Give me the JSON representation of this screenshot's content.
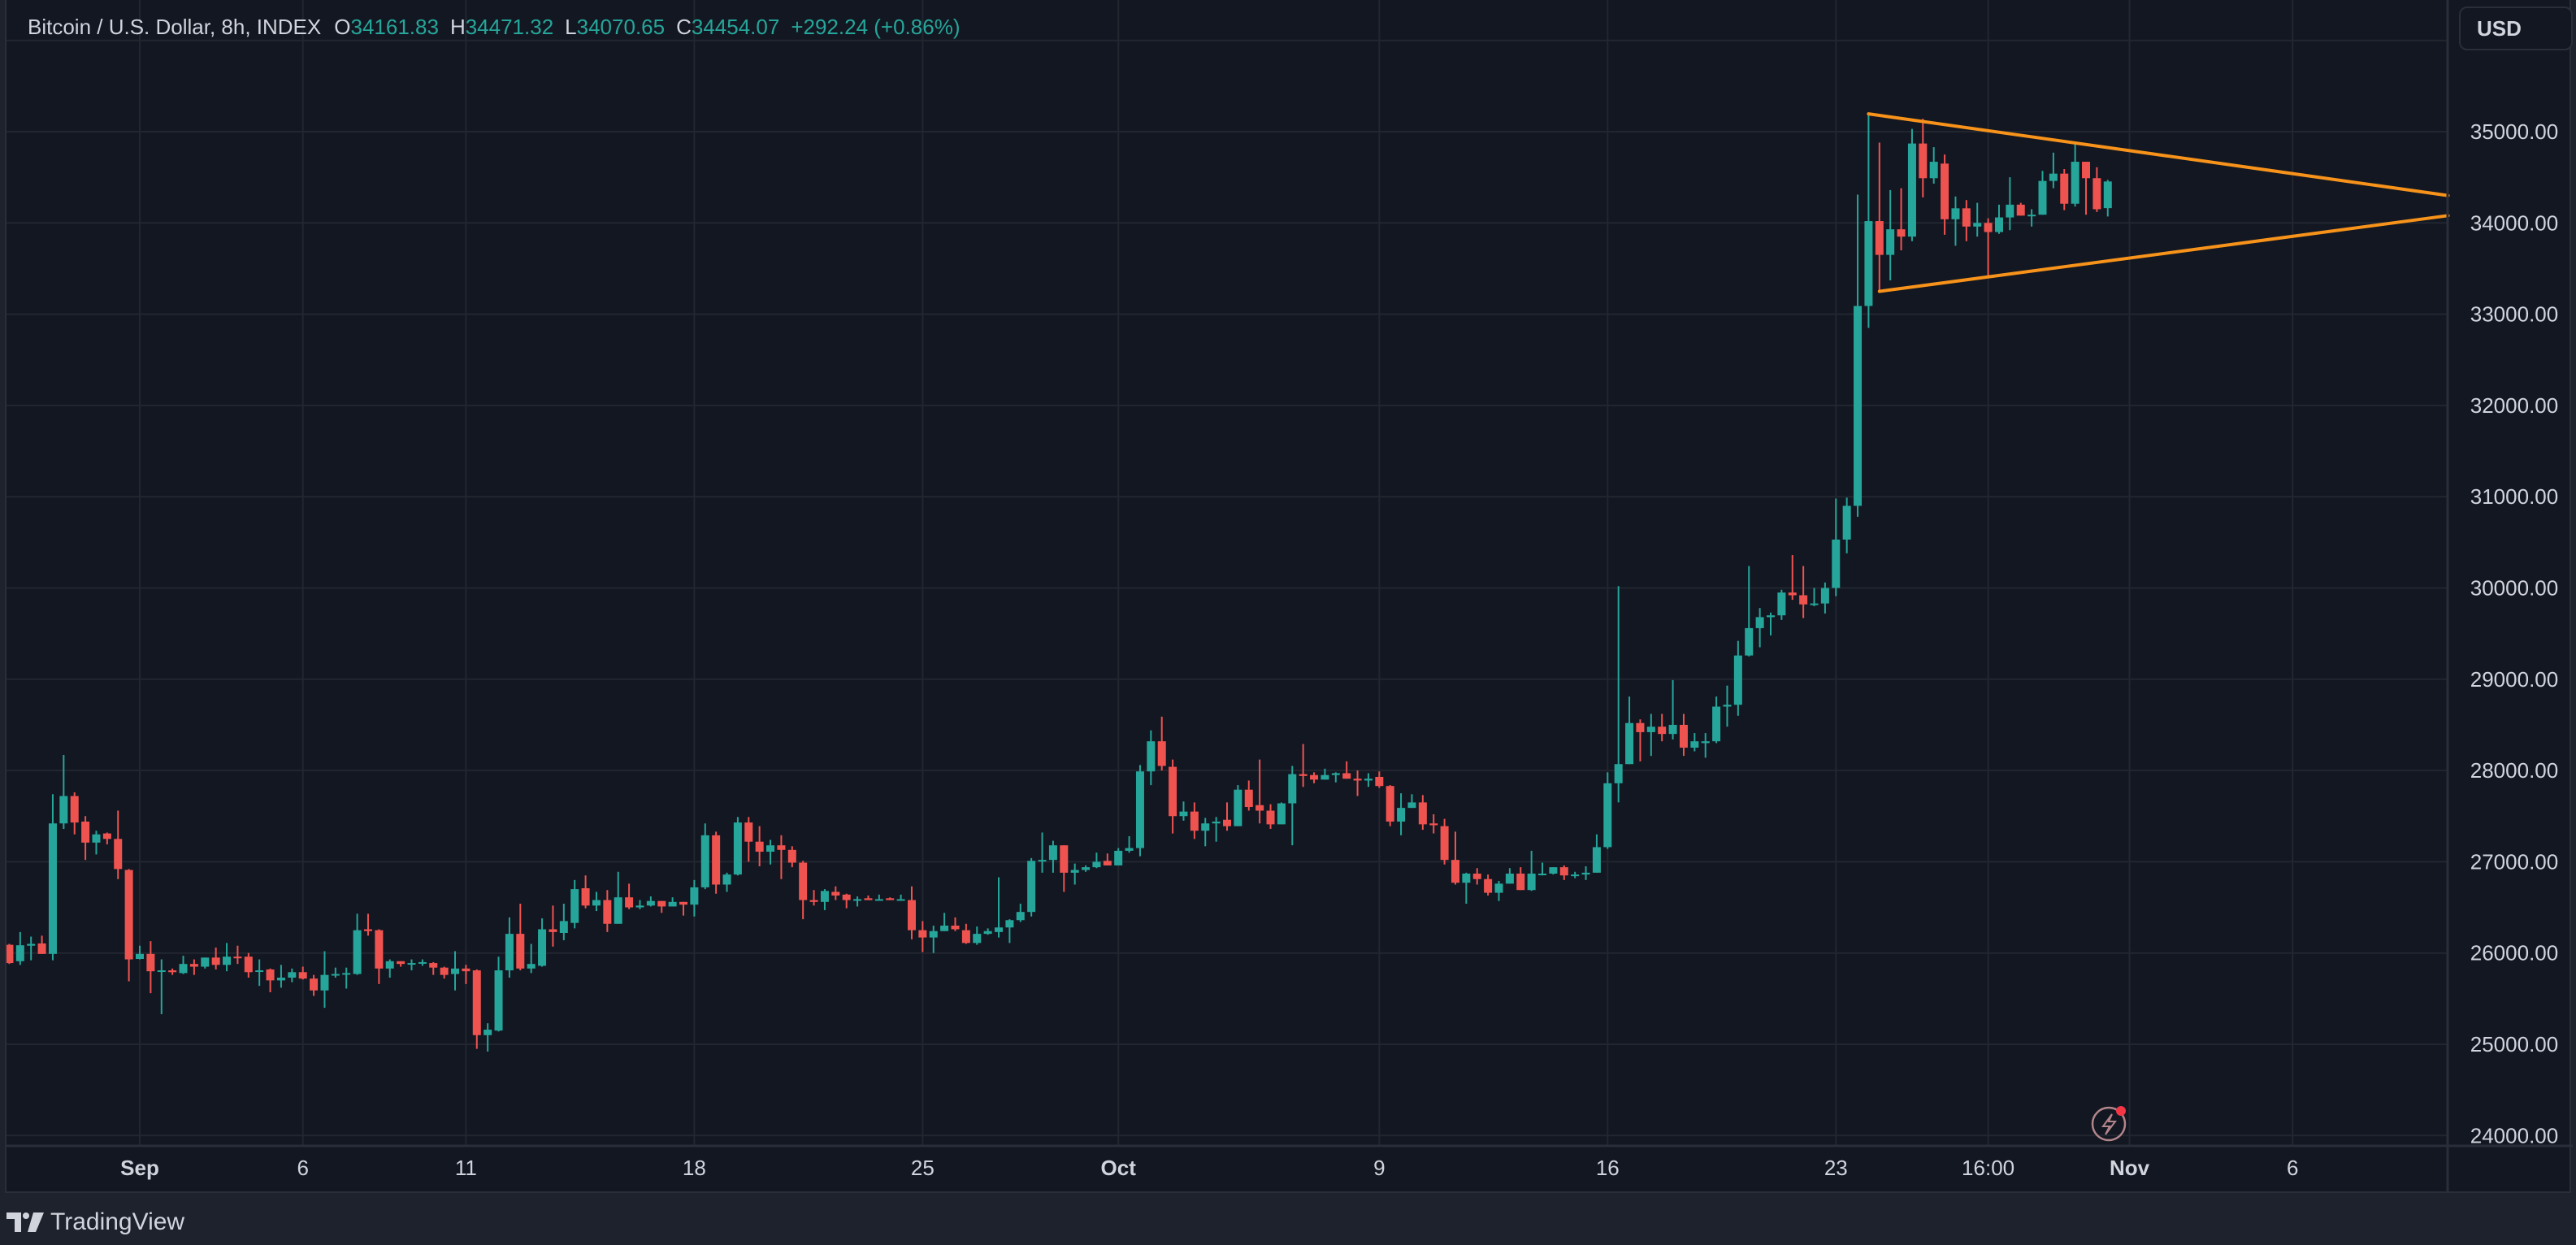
{
  "legend": {
    "symbol": "Bitcoin / U.S. Dollar, 8h, INDEX",
    "open_label": "O",
    "open": "34161.83",
    "high_label": "H",
    "high": "34471.32",
    "low_label": "L",
    "low": "34070.65",
    "close_label": "C",
    "close": "34454.07",
    "change": "+292.24 (+0.86%)"
  },
  "currency_button": "USD",
  "footer": {
    "brand": "TradingView",
    "logo_icon": "tradingview-logo-icon"
  },
  "flash_icon": {
    "name": "lightning-icon",
    "badge_color": "#f23645"
  },
  "colors": {
    "background": "#131722",
    "up": "#26a69a",
    "down": "#ef5350",
    "trendline": "#f7931a",
    "grid": "#22262f",
    "text": "#d1d4dc"
  },
  "chart_data": {
    "type": "candlestick",
    "title": "Bitcoin / U.S. Dollar, 8h, INDEX",
    "interval": "8h",
    "first_candle": "Aug 28 00:00",
    "first_candle_index_offset_from_sep1": -12,
    "ylim": [
      24000,
      36000
    ],
    "yticks": [
      "24000.00",
      "25000.00",
      "26000.00",
      "27000.00",
      "28000.00",
      "29000.00",
      "30000.00",
      "31000.00",
      "32000.00",
      "33000.00",
      "34000.00",
      "35000.00"
    ],
    "xticks": [
      {
        "label": "Sep",
        "index": 0,
        "major": true
      },
      {
        "label": "6",
        "index": 15
      },
      {
        "label": "11",
        "index": 30
      },
      {
        "label": "18",
        "index": 51
      },
      {
        "label": "25",
        "index": 72
      },
      {
        "label": "Oct",
        "index": 90,
        "major": true
      },
      {
        "label": "9",
        "index": 114
      },
      {
        "label": "16",
        "index": 135
      },
      {
        "label": "23",
        "index": 156
      },
      {
        "label": "16:00",
        "index": 170
      },
      {
        "label": "Nov",
        "index": 183,
        "major": true
      },
      {
        "label": "6",
        "index": 198
      }
    ],
    "x_range_index": [
      -12.6,
      212.3
    ],
    "grid": true,
    "ohlc": [
      [
        26090,
        26100,
        25880,
        25890
      ],
      [
        25910,
        26230,
        25870,
        26085
      ],
      [
        26080,
        26180,
        25920,
        26100
      ],
      [
        26105,
        26190,
        25990,
        25990
      ],
      [
        25990,
        27740,
        25920,
        27420
      ],
      [
        27420,
        28170,
        27360,
        27720
      ],
      [
        27720,
        27760,
        27300,
        27430
      ],
      [
        27440,
        27500,
        27020,
        27210
      ],
      [
        27210,
        27340,
        27080,
        27300
      ],
      [
        27310,
        27320,
        27190,
        27250
      ],
      [
        27250,
        27560,
        26810,
        26920
      ],
      [
        26910,
        26920,
        25690,
        25930
      ],
      [
        25935,
        26080,
        25930,
        25990
      ],
      [
        25990,
        26130,
        25560,
        25800
      ],
      [
        25800,
        25930,
        25330,
        25810
      ],
      [
        25810,
        25830,
        25760,
        25790
      ],
      [
        25780,
        25970,
        25770,
        25880
      ],
      [
        25880,
        25930,
        25760,
        25850
      ],
      [
        25850,
        25950,
        25830,
        25950
      ],
      [
        25950,
        26060,
        25820,
        25870
      ],
      [
        25870,
        26110,
        25800,
        25960
      ],
      [
        25960,
        26080,
        25880,
        25950
      ],
      [
        25960,
        26000,
        25730,
        25790
      ],
      [
        25800,
        25930,
        25640,
        25810
      ],
      [
        25820,
        25830,
        25570,
        25700
      ],
      [
        25700,
        25870,
        25620,
        25730
      ],
      [
        25730,
        25830,
        25680,
        25790
      ],
      [
        25790,
        25850,
        25710,
        25720
      ],
      [
        25720,
        25760,
        25530,
        25590
      ],
      [
        25590,
        26020,
        25400,
        25760
      ],
      [
        25760,
        25840,
        25730,
        25770
      ],
      [
        25770,
        25840,
        25610,
        25780
      ],
      [
        25770,
        26430,
        25760,
        26250
      ],
      [
        26260,
        26430,
        26190,
        26240
      ],
      [
        26250,
        26260,
        25660,
        25830
      ],
      [
        25830,
        25930,
        25730,
        25910
      ],
      [
        25910,
        25910,
        25850,
        25880
      ],
      [
        25880,
        25930,
        25810,
        25890
      ],
      [
        25890,
        25930,
        25860,
        25900
      ],
      [
        25890,
        25900,
        25760,
        25840
      ],
      [
        25840,
        25850,
        25720,
        25760
      ],
      [
        25770,
        26020,
        25590,
        25830
      ],
      [
        25830,
        25870,
        25660,
        25800
      ],
      [
        25810,
        25820,
        24950,
        25100
      ],
      [
        25100,
        25230,
        24920,
        25160
      ],
      [
        25150,
        25960,
        25140,
        25810
      ],
      [
        25810,
        26390,
        25730,
        26210
      ],
      [
        26210,
        26540,
        25810,
        25830
      ],
      [
        25830,
        26100,
        25780,
        25880
      ],
      [
        25860,
        26380,
        25850,
        26260
      ],
      [
        26260,
        26520,
        26070,
        26230
      ],
      [
        26220,
        26540,
        26140,
        26350
      ],
      [
        26330,
        26800,
        26270,
        26700
      ],
      [
        26710,
        26850,
        26490,
        26520
      ],
      [
        26520,
        26670,
        26460,
        26580
      ],
      [
        26580,
        26690,
        26230,
        26320
      ],
      [
        26320,
        26890,
        26320,
        26610
      ],
      [
        26610,
        26760,
        26480,
        26500
      ],
      [
        26500,
        26580,
        26480,
        26520
      ],
      [
        26520,
        26620,
        26510,
        26570
      ],
      [
        26570,
        26570,
        26440,
        26510
      ],
      [
        26510,
        26610,
        26510,
        26560
      ],
      [
        26560,
        26560,
        26410,
        26530
      ],
      [
        26530,
        26800,
        26400,
        26720
      ],
      [
        26720,
        27420,
        26700,
        27290
      ],
      [
        27290,
        27330,
        26650,
        26750
      ],
      [
        26750,
        26880,
        26670,
        26860
      ],
      [
        26860,
        27490,
        26850,
        27430
      ],
      [
        27430,
        27490,
        27000,
        27220
      ],
      [
        27220,
        27390,
        26950,
        27110
      ],
      [
        27110,
        27240,
        26970,
        27180
      ],
      [
        27180,
        27290,
        26810,
        27130
      ],
      [
        27130,
        27170,
        26940,
        26990
      ],
      [
        26990,
        27010,
        26370,
        26580
      ],
      [
        26580,
        26690,
        26520,
        26560
      ],
      [
        26560,
        26700,
        26470,
        26680
      ],
      [
        26670,
        26730,
        26580,
        26630
      ],
      [
        26640,
        26650,
        26490,
        26580
      ],
      [
        26580,
        26620,
        26510,
        26590
      ],
      [
        26600,
        26630,
        26580,
        26580
      ],
      [
        26580,
        26640,
        26580,
        26590
      ],
      [
        26600,
        26610,
        26580,
        26580
      ],
      [
        26580,
        26640,
        26580,
        26590
      ],
      [
        26580,
        26730,
        26150,
        26250
      ],
      [
        26250,
        26350,
        26010,
        26170
      ],
      [
        26170,
        26300,
        26000,
        26240
      ],
      [
        26240,
        26440,
        26240,
        26300
      ],
      [
        26300,
        26390,
        26240,
        26260
      ],
      [
        26250,
        26320,
        26100,
        26110
      ],
      [
        26110,
        26290,
        26090,
        26210
      ],
      [
        26210,
        26270,
        26200,
        26240
      ],
      [
        26230,
        26830,
        26170,
        26280
      ],
      [
        26280,
        26370,
        26110,
        26360
      ],
      [
        26360,
        26540,
        26340,
        26450
      ],
      [
        26450,
        27040,
        26400,
        27010
      ],
      [
        27010,
        27320,
        26880,
        27020
      ],
      [
        27020,
        27230,
        26880,
        27180
      ],
      [
        27180,
        27180,
        26670,
        26880
      ],
      [
        26880,
        26980,
        26750,
        26910
      ],
      [
        26910,
        26960,
        26890,
        26940
      ],
      [
        26940,
        27100,
        26930,
        27000
      ],
      [
        27010,
        27090,
        26960,
        26960
      ],
      [
        26960,
        27150,
        26960,
        27120
      ],
      [
        27120,
        27280,
        27100,
        27150
      ],
      [
        27150,
        28060,
        27060,
        27990
      ],
      [
        27990,
        28440,
        27840,
        28320
      ],
      [
        28320,
        28590,
        28000,
        28050
      ],
      [
        28040,
        28120,
        27310,
        27500
      ],
      [
        27500,
        27660,
        27450,
        27550
      ],
      [
        27550,
        27650,
        27250,
        27340
      ],
      [
        27340,
        27480,
        27170,
        27420
      ],
      [
        27420,
        27490,
        27220,
        27440
      ],
      [
        27460,
        27650,
        27340,
        27390
      ],
      [
        27390,
        27840,
        27390,
        27790
      ],
      [
        27790,
        27890,
        27560,
        27600
      ],
      [
        27620,
        28120,
        27420,
        27560
      ],
      [
        27560,
        27630,
        27360,
        27410
      ],
      [
        27410,
        27650,
        27410,
        27640
      ],
      [
        27640,
        28050,
        27180,
        27960
      ],
      [
        27960,
        28290,
        27820,
        27940
      ],
      [
        27950,
        27980,
        27860,
        27900
      ],
      [
        27900,
        28020,
        27900,
        27950
      ],
      [
        27950,
        27980,
        27870,
        27970
      ],
      [
        27970,
        28100,
        27910,
        27910
      ],
      [
        27910,
        28000,
        27720,
        27890
      ],
      [
        27890,
        27970,
        27820,
        27910
      ],
      [
        27930,
        27990,
        27810,
        27830
      ],
      [
        27830,
        27840,
        27390,
        27440
      ],
      [
        27440,
        27750,
        27290,
        27590
      ],
      [
        27590,
        27740,
        27590,
        27650
      ],
      [
        27650,
        27730,
        27350,
        27410
      ],
      [
        27420,
        27520,
        27310,
        27400
      ],
      [
        27390,
        27470,
        26970,
        27020
      ],
      [
        27020,
        27330,
        26750,
        26770
      ],
      [
        26770,
        26880,
        26540,
        26870
      ],
      [
        26870,
        26930,
        26750,
        26810
      ],
      [
        26810,
        26860,
        26630,
        26660
      ],
      [
        26660,
        26790,
        26570,
        26760
      ],
      [
        26760,
        26930,
        26760,
        26870
      ],
      [
        26870,
        26940,
        26690,
        26690
      ],
      [
        26690,
        27120,
        26680,
        26870
      ],
      [
        26860,
        26990,
        26850,
        26870
      ],
      [
        26870,
        26940,
        26860,
        26940
      ],
      [
        26940,
        26960,
        26800,
        26850
      ],
      [
        26850,
        26890,
        26820,
        26860
      ],
      [
        26860,
        26950,
        26800,
        26880
      ],
      [
        26880,
        27300,
        26880,
        27160
      ],
      [
        27160,
        27980,
        27140,
        27860
      ],
      [
        27860,
        30020,
        27650,
        28070
      ],
      [
        28070,
        28810,
        28070,
        28520
      ],
      [
        28520,
        28560,
        28100,
        28420
      ],
      [
        28420,
        28620,
        28160,
        28480
      ],
      [
        28480,
        28620,
        28320,
        28400
      ],
      [
        28400,
        28990,
        28340,
        28500
      ],
      [
        28500,
        28620,
        28160,
        28250
      ],
      [
        28250,
        28410,
        28210,
        28320
      ],
      [
        28300,
        28410,
        28140,
        28320
      ],
      [
        28320,
        28810,
        28300,
        28700
      ],
      [
        28700,
        28930,
        28480,
        28720
      ],
      [
        28720,
        29420,
        28600,
        29260
      ],
      [
        29260,
        30240,
        29250,
        29560
      ],
      [
        29560,
        29780,
        29350,
        29680
      ],
      [
        29680,
        29730,
        29480,
        29700
      ],
      [
        29700,
        29980,
        29650,
        29950
      ],
      [
        29950,
        30360,
        29870,
        29920
      ],
      [
        29920,
        30240,
        29670,
        29820
      ],
      [
        29820,
        30000,
        29800,
        29830
      ],
      [
        29830,
        30060,
        29720,
        30000
      ],
      [
        30000,
        30980,
        29910,
        30530
      ],
      [
        30530,
        30990,
        30380,
        30900
      ],
      [
        30900,
        34310,
        30780,
        33090
      ],
      [
        33090,
        35200,
        32850,
        34020
      ],
      [
        34020,
        34880,
        33250,
        33650
      ],
      [
        33650,
        34360,
        33370,
        33930
      ],
      [
        33930,
        34380,
        33700,
        33850
      ],
      [
        33850,
        35030,
        33800,
        34870
      ],
      [
        34870,
        35140,
        34280,
        34490
      ],
      [
        34490,
        34830,
        34430,
        34670
      ],
      [
        34650,
        34750,
        33870,
        34040
      ],
      [
        34040,
        34290,
        33750,
        34160
      ],
      [
        34160,
        34250,
        33800,
        33960
      ],
      [
        33960,
        34220,
        33850,
        34000
      ],
      [
        34000,
        34050,
        33410,
        33900
      ],
      [
        33900,
        34200,
        33880,
        34060
      ],
      [
        34060,
        34500,
        33920,
        34200
      ],
      [
        34200,
        34220,
        34080,
        34080
      ],
      [
        34080,
        34150,
        33960,
        34090
      ],
      [
        34090,
        34570,
        34090,
        34460
      ],
      [
        34460,
        34770,
        34380,
        34540
      ],
      [
        34540,
        34590,
        34140,
        34210
      ],
      [
        34210,
        34870,
        34180,
        34670
      ],
      [
        34670,
        34670,
        34090,
        34490
      ],
      [
        34490,
        34610,
        34120,
        34150
      ],
      [
        34161.83,
        34471.32,
        34070.65,
        34454.07
      ]
    ],
    "annotations": [
      {
        "type": "trendline",
        "name": "triangle-upper",
        "from": {
          "index": 159,
          "price": 35195
        },
        "to": {
          "index": 212.3,
          "price": 34300
        }
      },
      {
        "type": "trendline",
        "name": "triangle-lower",
        "from": {
          "index": 160,
          "price": 33250
        },
        "to": {
          "index": 212.3,
          "price": 34080
        }
      }
    ]
  }
}
